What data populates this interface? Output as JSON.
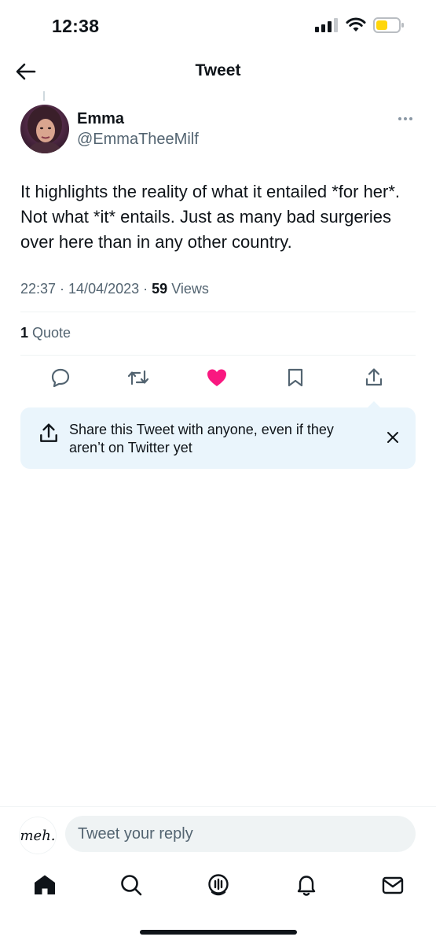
{
  "status_bar": {
    "time": "12:38"
  },
  "header": {
    "title": "Tweet"
  },
  "tweet": {
    "author_name": "Emma",
    "author_handle": "@EmmaTheeMilf",
    "text": "It highlights the reality of what it entailed *for her*. Not what *it* entails. Just as many bad surgeries over here than in any other country.",
    "timestamp": "22:37 · 14/04/2023",
    "separator": "·",
    "views_count": "59",
    "views_label": "Views",
    "quotes_count": "1",
    "quotes_label": "Quote",
    "liked": true
  },
  "actions": {
    "icons": [
      "reply-icon",
      "retweet-icon",
      "like-icon",
      "bookmark-icon",
      "share-icon"
    ]
  },
  "share_tip": {
    "text": "Share this Tweet with anyone, even if they aren’t on Twitter yet"
  },
  "reply": {
    "placeholder": "Tweet your reply",
    "avatar_text": "meh."
  },
  "tab_bar": {
    "tabs": [
      "home-icon",
      "search-icon",
      "spaces-icon",
      "notifications-icon",
      "messages-icon"
    ]
  },
  "colors": {
    "like": "#f91880",
    "text": "#0f1419",
    "secondary": "#536471",
    "tip_background": "#eaf5fc",
    "input_background": "#eff3f4",
    "battery": "#ffd60a"
  }
}
